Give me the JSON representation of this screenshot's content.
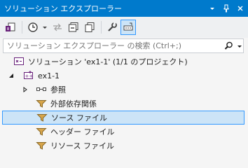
{
  "window": {
    "title": "ソリューション エクスプローラー",
    "title_buttons": [
      "dropdown-icon",
      "pin-icon",
      "close-icon"
    ]
  },
  "toolbar": {
    "buttons": [
      "switch-views-icon",
      "history-icon",
      "back-icon",
      "collapse-all-icon",
      "show-all-files-icon",
      "properties-icon",
      "preview-selected-icon"
    ]
  },
  "search": {
    "placeholder": "ソリューション エクスプローラー の検索 (Ctrl+;)"
  },
  "tree": {
    "solution_label": "ソリューション 'ex1-1' (1/1 のプロジェクト)",
    "project_label": "ex1-1",
    "items": [
      {
        "label": "参照"
      },
      {
        "label": "外部依存関係"
      },
      {
        "label": "ソース ファイル",
        "selected": true
      },
      {
        "label": "ヘッダー ファイル"
      },
      {
        "label": "リソース ファイル"
      }
    ]
  },
  "colors": {
    "titlebar": "#007acc",
    "selection": "#cce4f7",
    "selection_border": "#3399ff",
    "folder_filter": "#d7a54a"
  }
}
